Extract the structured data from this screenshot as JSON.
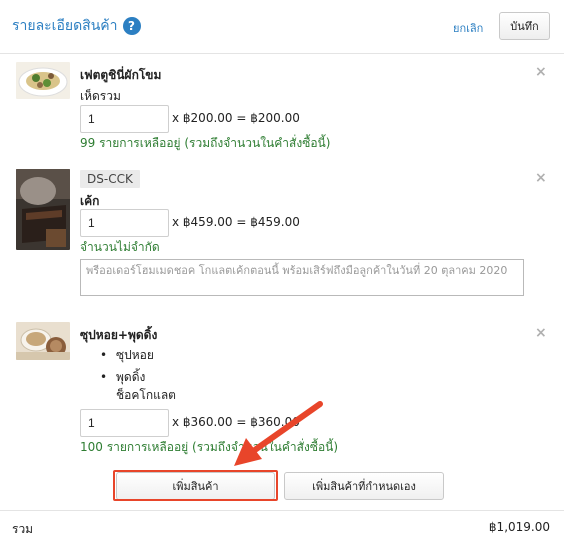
{
  "header": {
    "title": "รายละเอียดสินค้า",
    "help_glyph": "?",
    "cancel_label": "ยกเลิก",
    "save_label": "บันทึก"
  },
  "items": [
    {
      "name": "เฟตตูชินี่ผักโขม",
      "option": "เห็ดรวม",
      "quantity": "1",
      "price_line": "x ฿200.00 = ฿200.00",
      "stock": "99 รายการเหลืออยู่ (รวมถึงจำนวนในคำสั่งซื้อนี้)",
      "remove_glyph": "×"
    },
    {
      "sku": "DS-CCK",
      "name": "เค้ก",
      "quantity": "1",
      "price_line": "x ฿459.00 = ฿459.00",
      "stock": "จำนวนไม่จำกัด",
      "note": "พรีออเดอร์โฮมเมดชอค โกแลตเค้กตอนนี้ พร้อมเสิร์ฟถึงมือลูกค้าในวันที่ 20 ตุลาคม 2020",
      "remove_glyph": "×"
    },
    {
      "name": "ซุปหอย+พุดดิ้ง",
      "components": [
        "ซุปหอย",
        "พุดดิ้ง"
      ],
      "component_detail": "ช็อคโกแลต",
      "quantity": "1",
      "price_line": "x ฿360.00 = ฿360.00",
      "stock": "100 รายการเหลืออยู่ (รวมถึงจำนวนในคำสั่งซื้อนี้)",
      "remove_glyph": "×"
    }
  ],
  "actions": {
    "add_product_label": "เพิ่มสินค้า",
    "add_custom_label": "เพิ่มสินค้าที่กำหนดเอง"
  },
  "footer": {
    "total_label": "รวม",
    "total_value": "฿1,019.00"
  },
  "colors": {
    "accent": "#2c7fc2",
    "stock_green": "#2e7d32",
    "highlight": "#e8452a"
  }
}
